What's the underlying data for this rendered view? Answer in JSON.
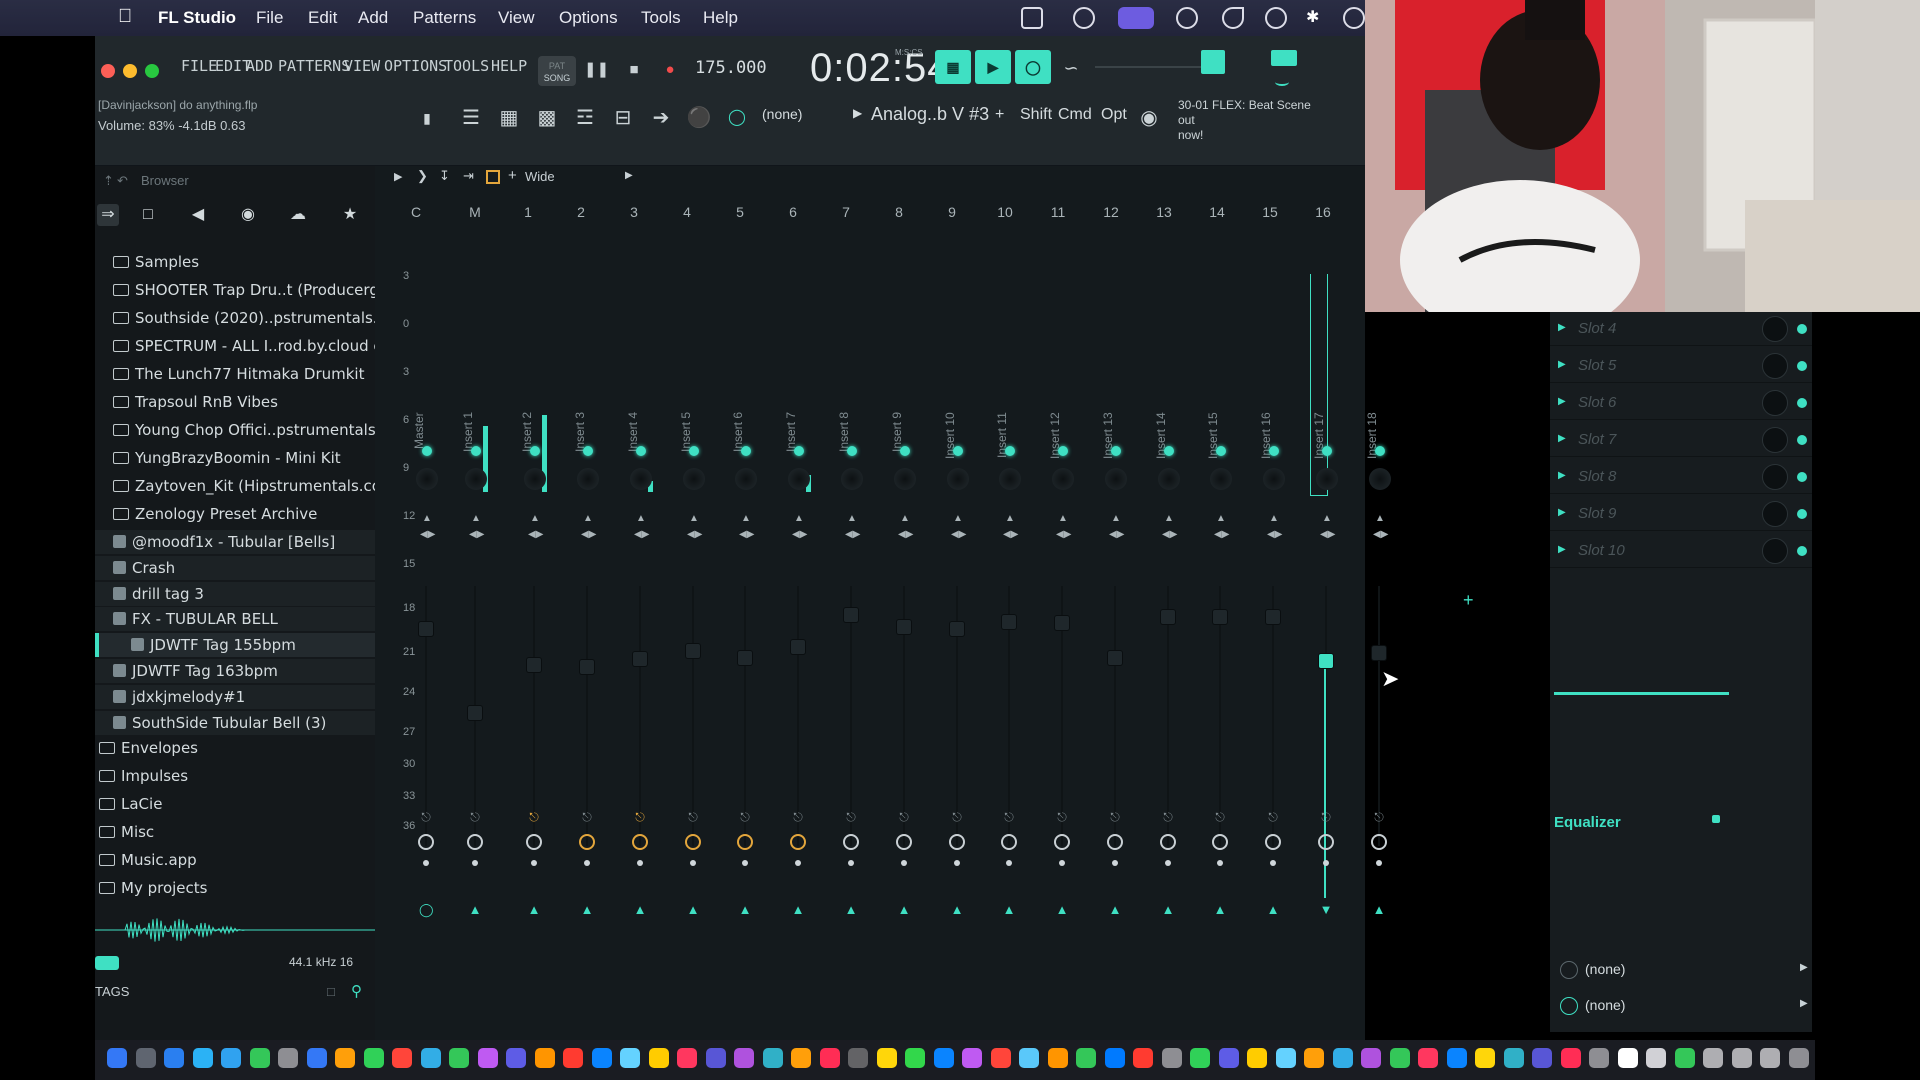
{
  "mac_menubar": {
    "app": "FL Studio",
    "items": [
      "File",
      "Edit",
      "Add",
      "Patterns",
      "View",
      "Options",
      "Tools",
      "Help"
    ]
  },
  "toolbar": {
    "menu": [
      "FILE",
      "EDIT",
      "ADD",
      "PATTERNS",
      "VIEW",
      "OPTIONS",
      "TOOLS",
      "HELP"
    ],
    "pat_label": "PAT",
    "song_label": "SONG",
    "tempo": "175.000",
    "time": "0:02:54",
    "time_sub": "M:S:CS",
    "project_hint": "[Davinjackson] do anything.flp",
    "volume_hint": "Volume: 83%  -4.1dB  0.63",
    "pattern_none": "(none)",
    "preset": "Analog..b V #3",
    "mod_keys": [
      "Shift",
      "Cmd",
      "Opt"
    ],
    "flex_line1": "30-01  FLEX: Beat Scene out",
    "flex_line2": "now!"
  },
  "browser": {
    "header": "Browser",
    "items": [
      {
        "label": "Samples",
        "type": "folder",
        "indent": 1
      },
      {
        "label": "SHOOTER Trap Dru..t (Producergrind)",
        "type": "folder",
        "indent": 1
      },
      {
        "label": "Southside (2020)..pstrumentals.com)",
        "type": "folder",
        "indent": 1
      },
      {
        "label": "SPECTRUM - ALL I..rod.by.cloud copy",
        "type": "folder",
        "indent": 1
      },
      {
        "label": "The Lunch77 Hitmaka Drumkit",
        "type": "folder",
        "indent": 1
      },
      {
        "label": "Trapsoul RnB Vibes",
        "type": "folder",
        "indent": 1
      },
      {
        "label": "Young Chop Offici..pstrumentals.com)",
        "type": "folder",
        "indent": 1
      },
      {
        "label": "YungBrazyBoomin - Mini Kit",
        "type": "folder",
        "indent": 1
      },
      {
        "label": "Zaytoven_Kit (Hipstrumentals.com)",
        "type": "folder",
        "indent": 1
      },
      {
        "label": "Zenology Preset Archive",
        "type": "folder",
        "indent": 1
      },
      {
        "label": "@moodf1x - Tubular [Bells]",
        "type": "file",
        "indent": 1
      },
      {
        "label": "Crash",
        "type": "file",
        "indent": 1
      },
      {
        "label": "drill tag 3",
        "type": "file",
        "indent": 1
      },
      {
        "label": "FX - TUBULAR BELL",
        "type": "file",
        "indent": 1
      },
      {
        "label": "JDWTF Tag 155bpm",
        "type": "file",
        "indent": 2
      },
      {
        "label": "JDWTF Tag 163bpm",
        "type": "file",
        "indent": 1
      },
      {
        "label": "jdxkjmelody#1",
        "type": "file",
        "indent": 1
      },
      {
        "label": "SouthSide Tubular Bell (3)",
        "type": "file",
        "indent": 1
      },
      {
        "label": "Envelopes",
        "type": "folder",
        "indent": 0
      },
      {
        "label": "Impulses",
        "type": "folder",
        "indent": 0
      },
      {
        "label": "LaCie",
        "type": "folder",
        "indent": 0
      },
      {
        "label": "Misc",
        "type": "folder",
        "indent": 0
      },
      {
        "label": "Music.app",
        "type": "folder",
        "indent": 0
      },
      {
        "label": "My projects",
        "type": "folder",
        "indent": 0
      }
    ],
    "sample_info": "44.1 kHz 16",
    "tags_label": "TAGS"
  },
  "mixer": {
    "view_mode": "Wide",
    "track_numbers": [
      "C",
      "M",
      "1",
      "2",
      "3",
      "4",
      "5",
      "6",
      "7",
      "8",
      "9",
      "10",
      "11",
      "12",
      "13",
      "14",
      "15",
      "16"
    ],
    "db_scale": [
      "3",
      "0",
      "3",
      "6",
      "9",
      "12",
      "15",
      "18",
      "21",
      "24",
      "27",
      "30",
      "33",
      "36"
    ],
    "strips": [
      "Master",
      "Insert 1",
      "Insert 2",
      "Insert 3",
      "Insert 4",
      "Insert 5",
      "Insert 6",
      "Insert 7",
      "Insert 8",
      "Insert 9",
      "Insert 10",
      "Insert 11",
      "Insert 12",
      "Insert 13",
      "Insert 14",
      "Insert 15",
      "Insert 16",
      "Insert 17",
      "Insert 18"
    ],
    "meter_levels": [
      0,
      0.6,
      0.7,
      0,
      0.1,
      0,
      0,
      0.15,
      0,
      0,
      0,
      0,
      0,
      0,
      0,
      0,
      0,
      0,
      0
    ],
    "fader_levels": [
      0.7,
      0.0,
      0.4,
      0.38,
      0.45,
      0.52,
      0.46,
      0.55,
      0.82,
      0.72,
      0.7,
      0.76,
      0.75,
      0.46,
      0.8,
      0.8,
      0.8,
      0.75,
      0.5
    ],
    "orange_clocks": [
      3,
      4,
      5,
      6,
      7
    ],
    "selected_strip": "Insert 17"
  },
  "fx_panel": {
    "slots": [
      "Slot 4",
      "Slot 5",
      "Slot 6",
      "Slot 7",
      "Slot 8",
      "Slot 9",
      "Slot 10"
    ],
    "equalizer": "Equalizer",
    "out_a": "(none)",
    "out_b": "(none)"
  },
  "colors": {
    "accent": "#3fe0c3",
    "orange": "#e3a63c"
  }
}
